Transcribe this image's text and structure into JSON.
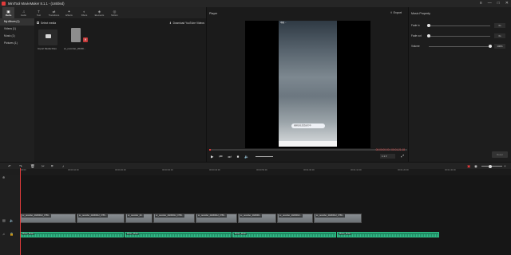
{
  "window": {
    "title": "MiniTool MovieMaker 8.1.1 - (Untitled)",
    "controls": [
      "≡",
      "—",
      "□",
      "✕"
    ]
  },
  "toolbar": {
    "items": [
      {
        "label": "Media",
        "icon": "folder-icon",
        "glyph": "▣",
        "active": true
      },
      {
        "label": "Audio",
        "icon": "music-icon",
        "glyph": "♫",
        "active": false
      },
      {
        "label": "Text",
        "icon": "text-icon",
        "glyph": "T",
        "active": false
      },
      {
        "label": "Transitions",
        "icon": "transition-icon",
        "glyph": "⇄",
        "active": false
      },
      {
        "label": "Effects",
        "icon": "effects-icon",
        "glyph": "✦",
        "active": false
      },
      {
        "label": "Filters",
        "icon": "filter-icon",
        "glyph": "◐",
        "active": false
      },
      {
        "label": "Elements",
        "icon": "elements-icon",
        "glyph": "◈",
        "active": false
      },
      {
        "label": "Motion",
        "icon": "motion-icon",
        "glyph": "◎",
        "active": false
      }
    ]
  },
  "library": {
    "sidebar": [
      {
        "label": "My Album (1)",
        "active": true
      },
      {
        "label": "Videos (1)",
        "active": false
      },
      {
        "label": "Music (1)",
        "active": false
      },
      {
        "label": "Pictures (1)",
        "active": false
      }
    ],
    "select_all": "Select media",
    "download_label": "Download YouTube Videos",
    "items": [
      {
        "label": "Import Media Files"
      },
      {
        "label": "sc_recorder_20230..."
      }
    ]
  },
  "player": {
    "title": "Player",
    "export_label": "Export",
    "phone_status": "中国 ...",
    "toast_text": "录屏已在后台运行中",
    "timecode": "00:00:00:00 / 00:01:21:18",
    "ratio": "1:1",
    "progress_fraction": 0.01
  },
  "properties": {
    "title": "Music Property",
    "rows": [
      {
        "label": "Fade in",
        "value": "0s",
        "fraction": 0.0
      },
      {
        "label": "Fade out",
        "value": "0s",
        "fraction": 0.0
      },
      {
        "label": "Volume",
        "value": "100%",
        "fraction": 1.0
      }
    ],
    "apply_label": "Reset"
  },
  "timeline": {
    "ruler": [
      "00:00",
      "00:00:10:00",
      "00:00:20:00",
      "00:00:30:00",
      "00:00:40:00",
      "00:00:50:00",
      "00:01:00:00",
      "00:01:10:00",
      "00:01:20:00",
      "00:01:30:00"
    ],
    "video_clips": [
      "sc_recorder_20230612_0759...",
      "sc_recorder_20230612_0755...",
      "sc_recorder_20...",
      "sc_recorder_20230612_0759...",
      "sc_recorder_20230612_0759...",
      "sc_recorder_2023061...",
      "sc_recorder_20230612...",
      "sc_recorder_20230612_0759..."
    ],
    "audio_clips": [
      "Photo_Music",
      "Photo_Music",
      "Photo_Music",
      "Photo_Music"
    ]
  },
  "colors": {
    "accent": "#e23b3b",
    "audio": "#1f8a63",
    "panel": "#1b1b1b"
  }
}
